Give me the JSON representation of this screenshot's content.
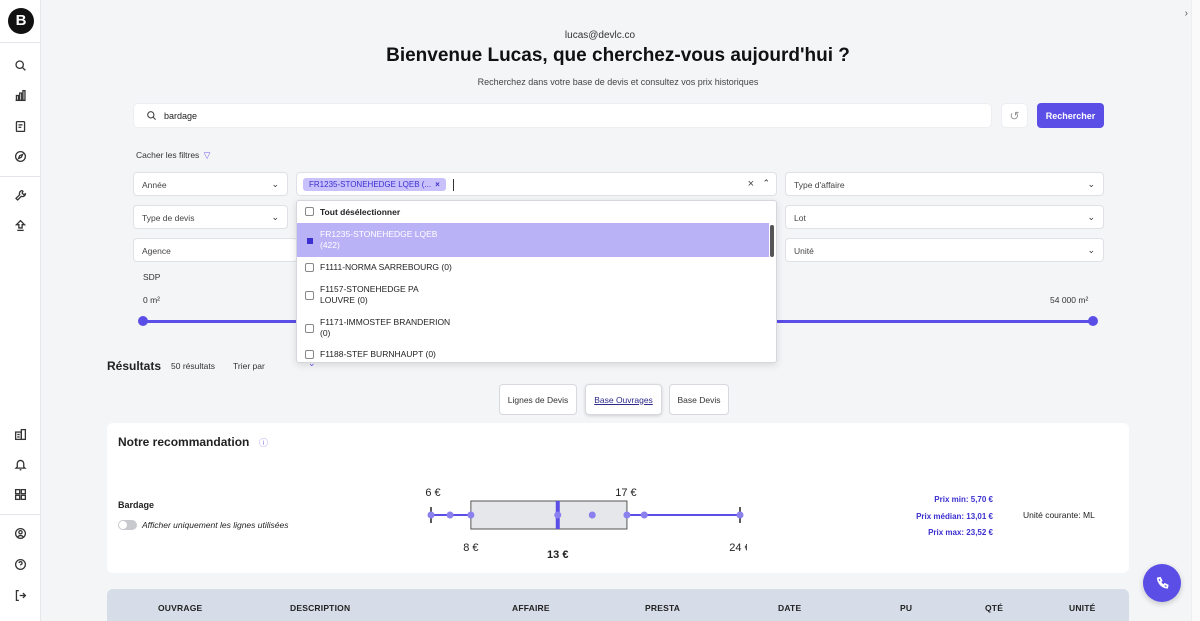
{
  "app": {
    "logo_text": "B",
    "accent_color": "#5b4ee6"
  },
  "sidebar": {
    "items": [
      {
        "name": "search-icon"
      },
      {
        "name": "chart-icon"
      },
      {
        "name": "document-icon"
      },
      {
        "name": "compass-icon"
      },
      {
        "name": "wrench-icon"
      },
      {
        "name": "upload-icon"
      },
      {
        "name": "building-icon"
      },
      {
        "name": "bell-icon"
      },
      {
        "name": "grid-icon"
      },
      {
        "name": "user-icon"
      },
      {
        "name": "help-icon"
      },
      {
        "name": "logout-icon"
      }
    ]
  },
  "header": {
    "email": "lucas@devlc.co",
    "welcome": "Bienvenue Lucas, que cherchez-vous aujourd'hui ?",
    "subtitle": "Recherchez dans votre base de devis et consultez vos prix historiques"
  },
  "search": {
    "value": "bardage",
    "button_label": "Rechercher"
  },
  "filters": {
    "toggle_label": "Cacher les filtres",
    "annee": "Année",
    "type_devis": "Type de devis",
    "agence": "Agence",
    "type_affaire": "Type d'affaire",
    "lot": "Lot",
    "unite": "Unité",
    "affaire_chip": "FR1235-STONEHEDGE LQEB (...",
    "sdp_label": "SDP",
    "sdp_min": "0 m²",
    "sdp_max": "54 000 m²",
    "sdp_range": [
      0,
      54000
    ]
  },
  "dropdown": {
    "deselect_all": "Tout désélectionner",
    "options": [
      {
        "line1": "FR1235-STONEHEDGE LQEB",
        "line2": "(422)",
        "selected": true
      },
      {
        "line1": "F1111-NORMA SARREBOURG (0)",
        "line2": "",
        "selected": false
      },
      {
        "line1": "F1157-STONEHEDGE PA",
        "line2": "LOUVRE (0)",
        "selected": false
      },
      {
        "line1": "F1171-IMMOSTEF BRANDERION",
        "line2": "(0)",
        "selected": false
      },
      {
        "line1": "F1188-STEF BURNHAUPT (0)",
        "line2": "",
        "selected": false
      }
    ]
  },
  "results": {
    "title": "Résultats",
    "count": "50 résultats",
    "sort_label": "Trier par",
    "views": [
      "Lignes de Devis",
      "Base Ouvrages",
      "Base Devis"
    ],
    "active_view": "Base Ouvrages"
  },
  "recommendation": {
    "title": "Notre recommandation",
    "product": "Bardage",
    "toggle_label": "Afficher uniquement les lignes utilisées",
    "toggle_on": false,
    "boxplot": {
      "min_label": "6 €",
      "q1_label": "8 €",
      "median_label": "13 €",
      "q3_label": "17 €",
      "max_label": "24 €",
      "min": 5.7,
      "q1": 8,
      "median": 13.01,
      "q3": 17,
      "max": 23.52,
      "points": [
        5.7,
        6.8,
        8,
        13.01,
        15,
        17,
        18,
        23.52
      ]
    },
    "price_min": "Prix min: 5,70 €",
    "price_median": "Prix médian: 13,01 €",
    "price_max": "Prix max: 23,52 €",
    "current_unit": "Unité courante: ML"
  },
  "table": {
    "columns": [
      "OUVRAGE",
      "DESCRIPTION",
      "AFFAIRE",
      "PRESTA",
      "DATE",
      "PU",
      "QTÉ",
      "UNITÉ"
    ]
  }
}
